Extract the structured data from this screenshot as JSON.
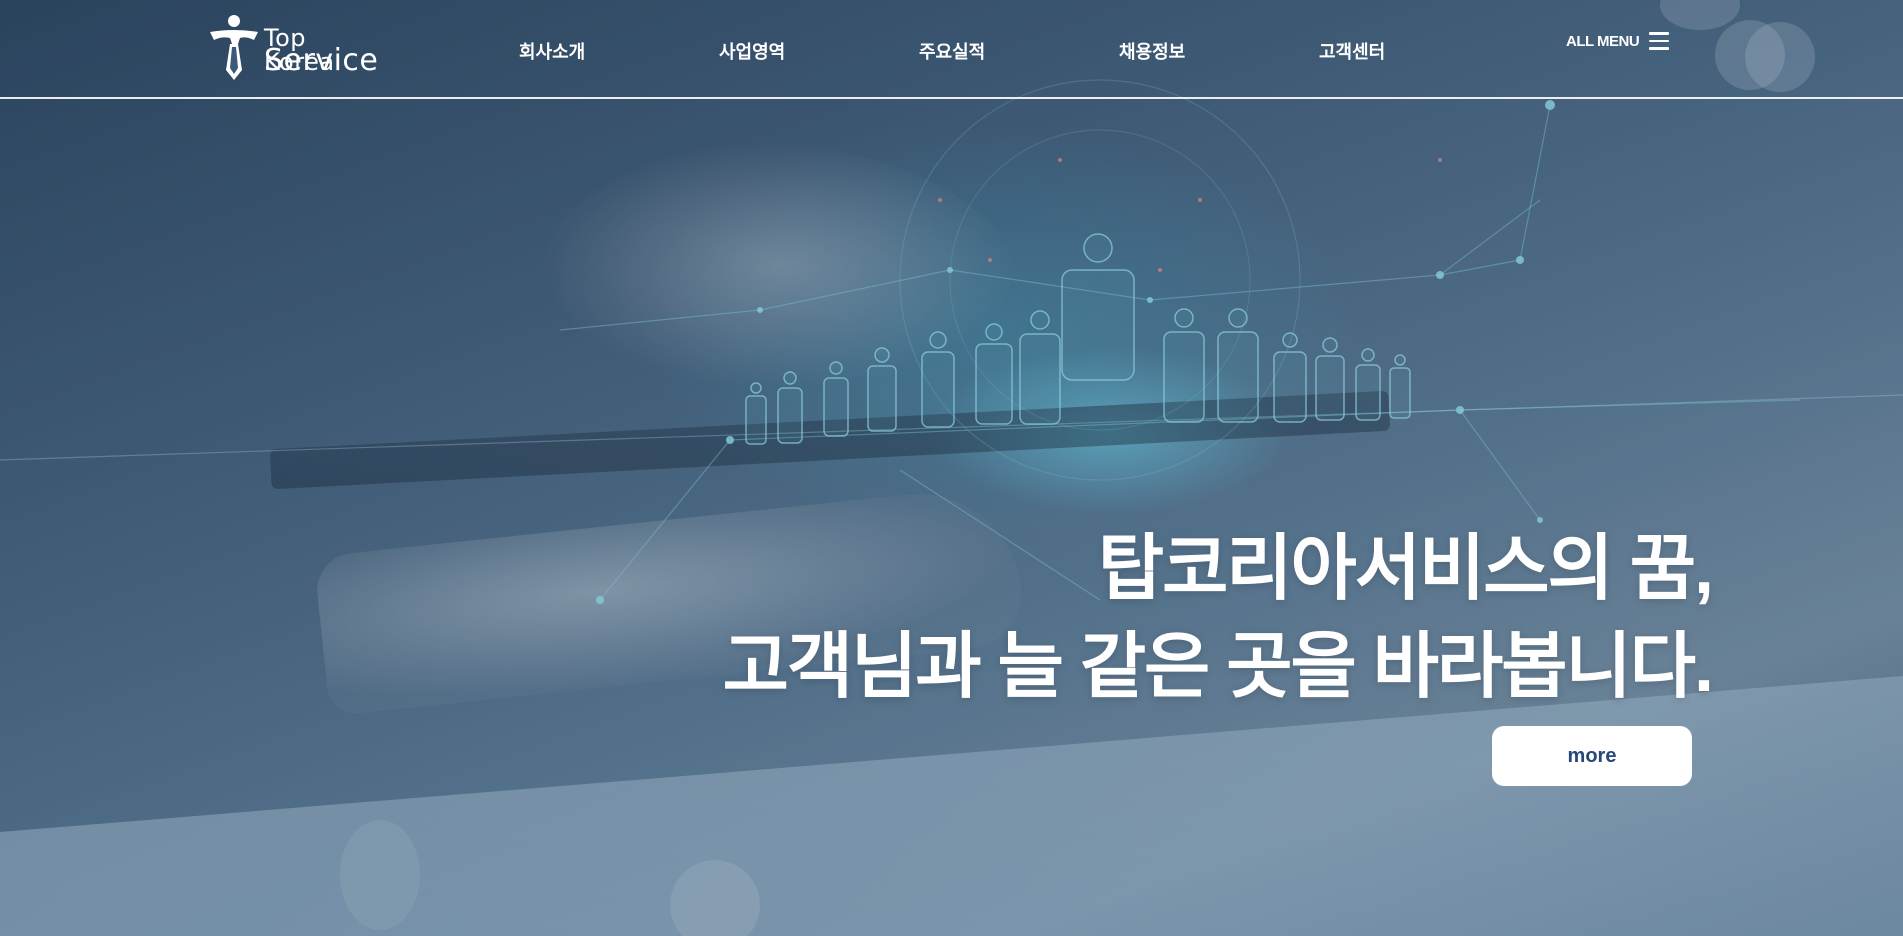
{
  "header": {
    "logo": {
      "line1": "Top Korea",
      "line2": "Service"
    },
    "nav": [
      {
        "label": "회사소개"
      },
      {
        "label": "사업영역"
      },
      {
        "label": "주요실적"
      },
      {
        "label": "채용정보"
      },
      {
        "label": "고객센터"
      }
    ],
    "all_menu_label": "ALL MENU",
    "all_menu_icon": "hamburger-icon"
  },
  "hero": {
    "headline_line1": "탑코리아서비스의 꿈,",
    "headline_line2": "고객님과 늘 같은 곳을 바라봅니다.",
    "more_label": "more"
  },
  "colors": {
    "text": "#ffffff",
    "button_bg": "#ffffff",
    "button_text": "#27467a",
    "accent_glow": "#4fd0e6"
  }
}
